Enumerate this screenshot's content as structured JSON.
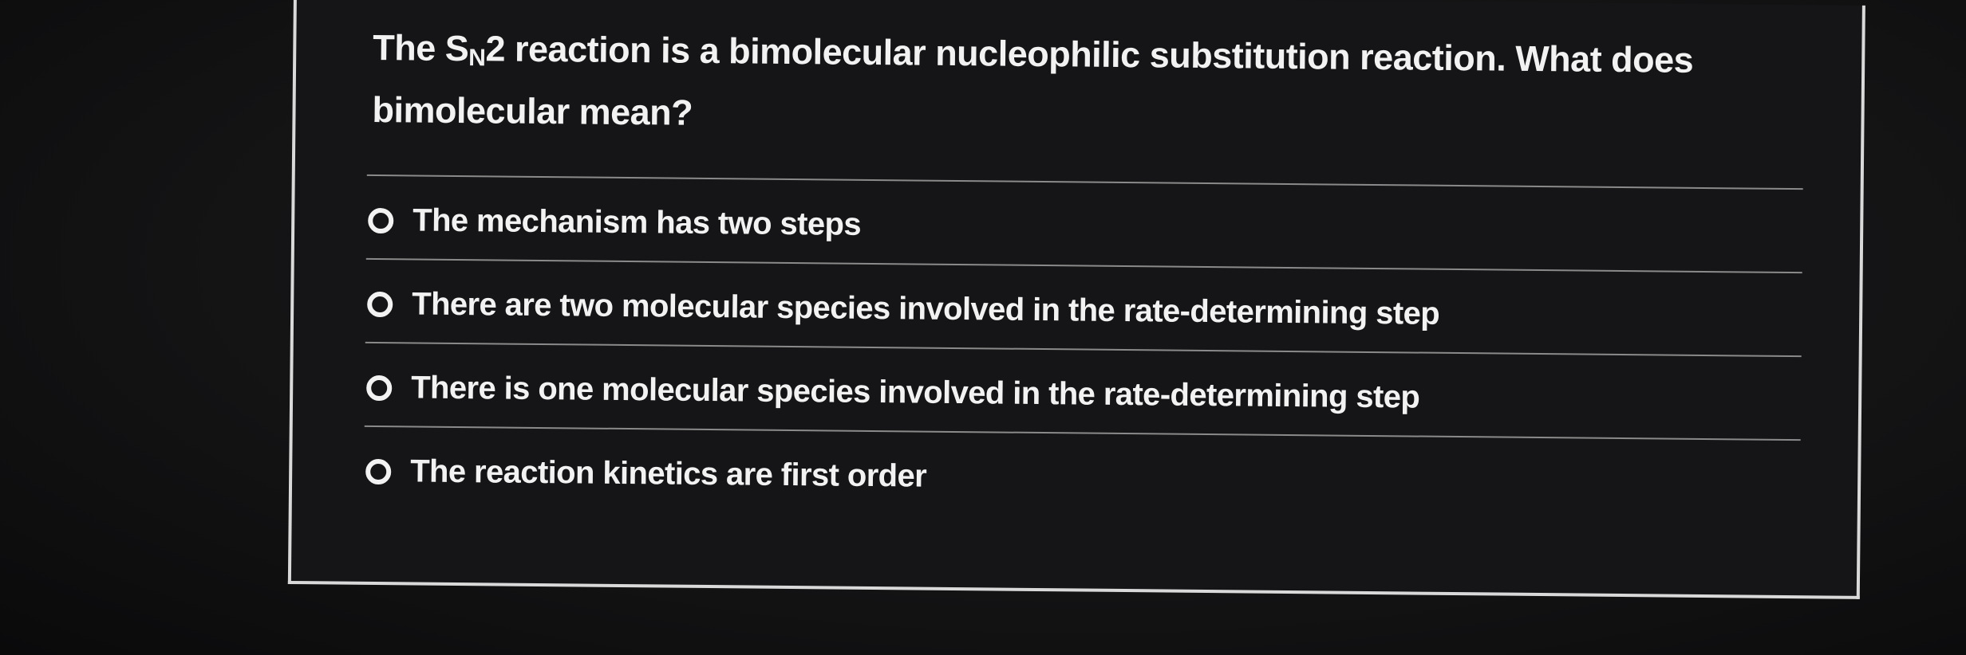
{
  "question": {
    "prefix": "The S",
    "subscript": "N",
    "suffix": "2 reaction is a bimolecular nucleophilic substitution reaction. What does bimolecular mean?"
  },
  "options": [
    {
      "label": "The mechanism has two steps",
      "selected": false
    },
    {
      "label": "There are two molecular species involved in the rate-determining step",
      "selected": false
    },
    {
      "label": "There is one molecular species involved in the rate-determining step",
      "selected": false
    },
    {
      "label": "The reaction kinetics are first order",
      "selected": false
    }
  ],
  "colors": {
    "background": "#141415",
    "text": "#f2f2f2",
    "border": "#d9d9d9",
    "divider": "#8a8a8a"
  }
}
